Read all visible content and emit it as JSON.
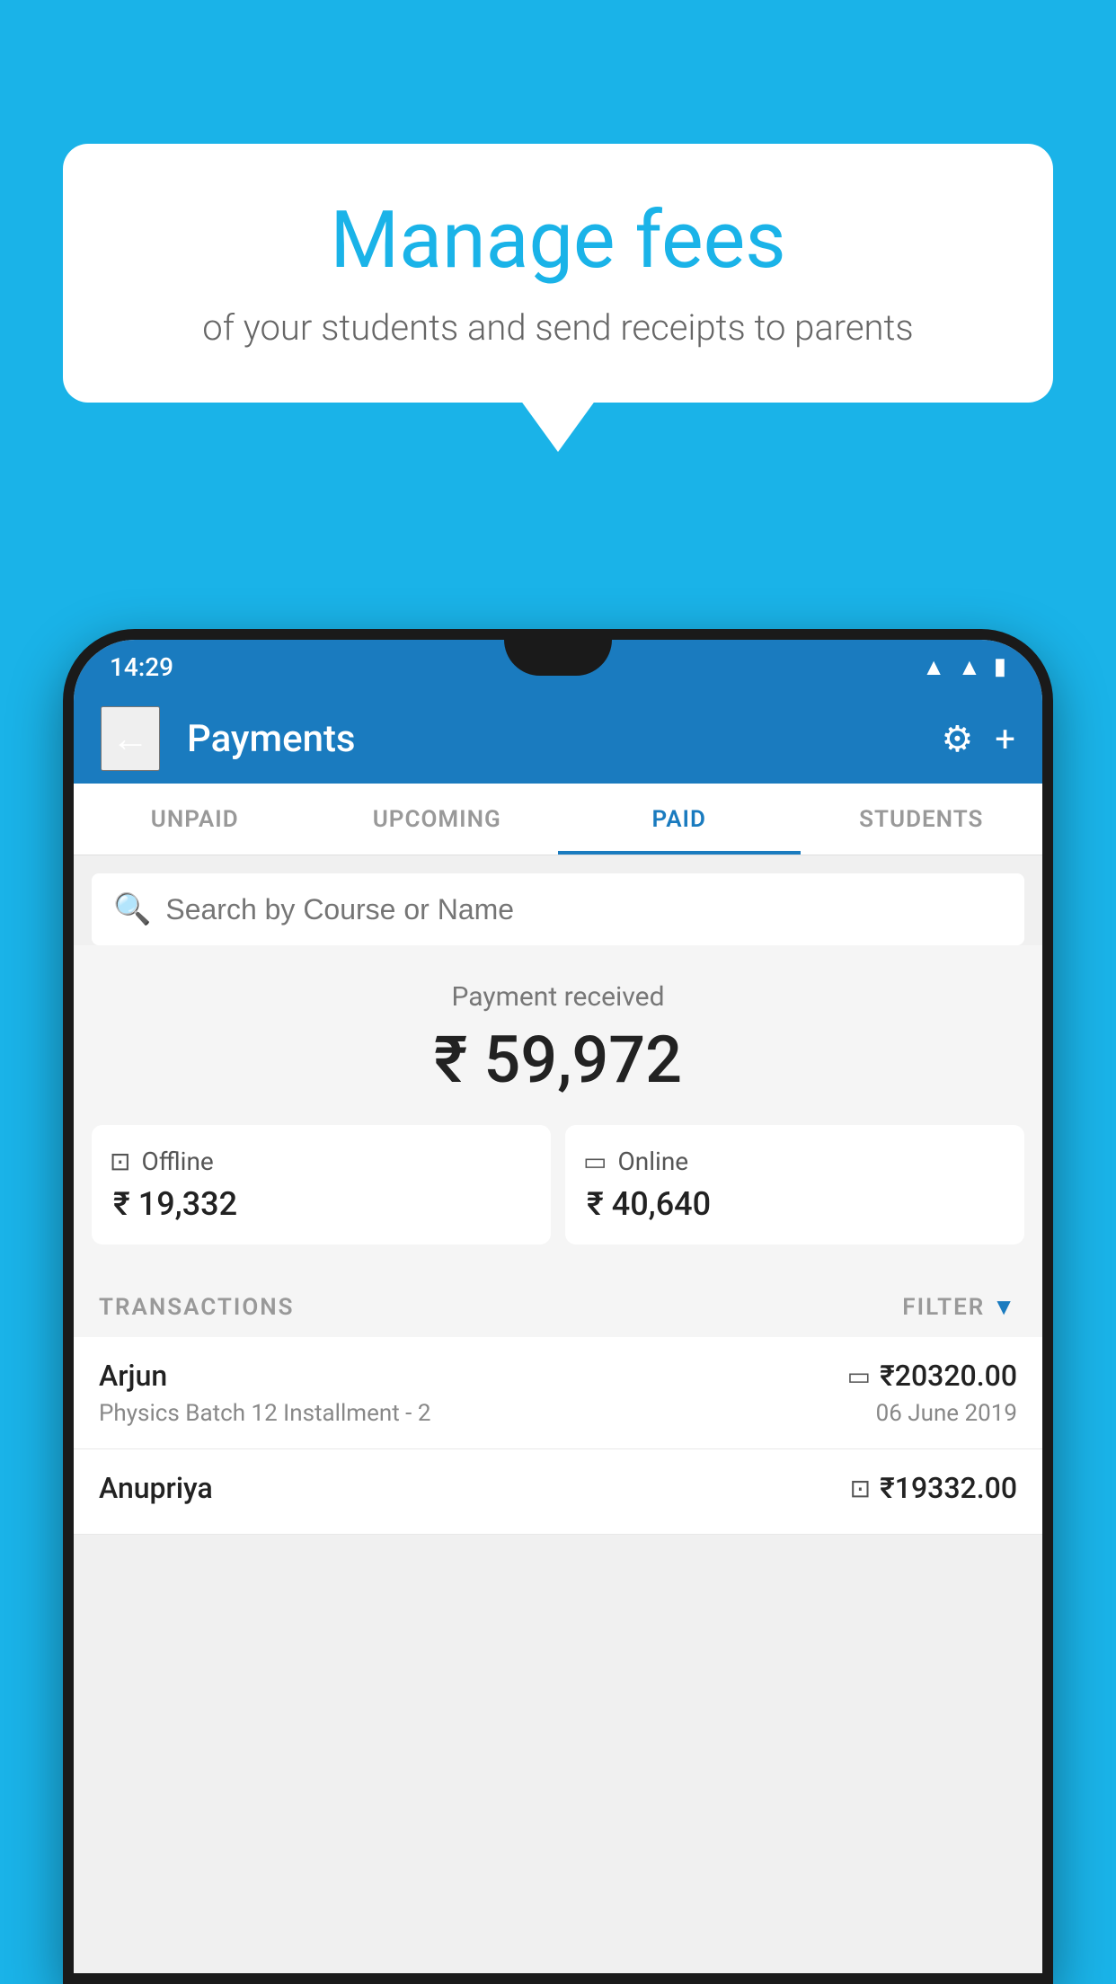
{
  "background_color": "#1ab3e8",
  "bubble": {
    "title": "Manage fees",
    "subtitle": "of your students and send receipts to parents"
  },
  "status_bar": {
    "time": "14:29",
    "icons": [
      "wifi",
      "signal",
      "battery"
    ]
  },
  "app_bar": {
    "title": "Payments",
    "back_label": "←",
    "settings_label": "⚙",
    "add_label": "+"
  },
  "tabs": [
    {
      "id": "unpaid",
      "label": "UNPAID",
      "active": false
    },
    {
      "id": "upcoming",
      "label": "UPCOMING",
      "active": false
    },
    {
      "id": "paid",
      "label": "PAID",
      "active": true
    },
    {
      "id": "students",
      "label": "STUDENTS",
      "active": false
    }
  ],
  "search": {
    "placeholder": "Search by Course or Name"
  },
  "payment_summary": {
    "label": "Payment received",
    "total": "₹ 59,972",
    "offline_label": "Offline",
    "offline_amount": "₹ 19,332",
    "online_label": "Online",
    "online_amount": "₹ 40,640"
  },
  "transactions": {
    "header_label": "TRANSACTIONS",
    "filter_label": "FILTER",
    "items": [
      {
        "name": "Arjun",
        "course": "Physics Batch 12 Installment - 2",
        "amount": "₹20320.00",
        "date": "06 June 2019",
        "type": "online"
      },
      {
        "name": "Anupriya",
        "course": "",
        "amount": "₹19332.00",
        "date": "",
        "type": "offline"
      }
    ]
  }
}
